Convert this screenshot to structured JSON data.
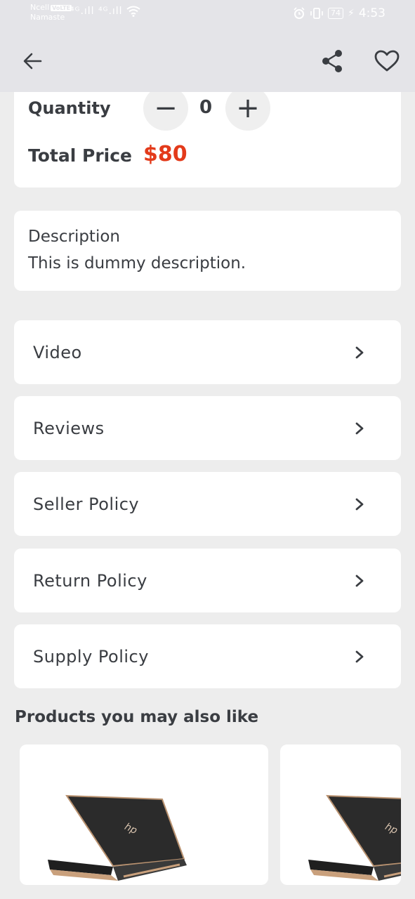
{
  "status_bar": {
    "carrier": "Ncell",
    "carrier_badge": "VoLTE",
    "network_name": "Namaste",
    "signals": "⁴ᴳ.ıll ⁴ᴳ.ıll",
    "battery": "74",
    "time": "4:53"
  },
  "top_bar": {
    "back_icon": "arrow-left-icon",
    "share_icon": "share-icon",
    "favorite_icon": "heart-outline-icon"
  },
  "quantity": {
    "label": "Quantity",
    "value": "0",
    "minus": "−",
    "plus": "+"
  },
  "total": {
    "label": "Total Price",
    "value": "$80"
  },
  "description": {
    "title": "Description",
    "text": "This is dummy description."
  },
  "menu": [
    {
      "label": "Video"
    },
    {
      "label": "Reviews"
    },
    {
      "label": "Seller Policy"
    },
    {
      "label": "Return Policy"
    },
    {
      "label": "Supply Policy"
    }
  ],
  "recommendations": {
    "title": "Products you may also like"
  },
  "colors": {
    "background": "#ededed",
    "card": "#ffffff",
    "text": "#3a3d42",
    "price": "#e33a1a",
    "topbar": "#e4e4e8"
  }
}
